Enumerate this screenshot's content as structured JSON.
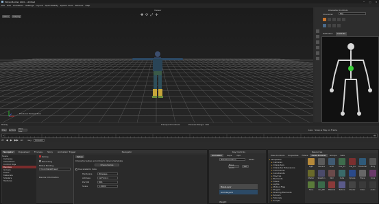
{
  "window": {
    "title": "MotionBuilder 2020 - Untitled",
    "controls": [
      "─",
      "□",
      "✕"
    ]
  },
  "menu": [
    "File",
    "Edit",
    "Animation",
    "Settings",
    "Layout",
    "Open Reality",
    "Python Tools",
    "Window",
    "Help"
  ],
  "viewport": {
    "top_label": "Viewer",
    "left_buttons": [
      "Menu",
      "Display"
    ],
    "camera_label": "Producer Perspective",
    "status_left": "Ready"
  },
  "character_controls": {
    "title": "Character Controls",
    "character_label": "Character",
    "character_value": "Mia",
    "tabs": [
      "Definition",
      "Controls"
    ],
    "active_tab": "Controls"
  },
  "status_bar": {
    "left": "Transport Controls",
    "right": "Preview Range: 100"
  },
  "timeline": {
    "start": "0",
    "end": "100",
    "labels": [
      "Play",
      "Action",
      "Take 001"
    ],
    "key_label": "Key",
    "interp_label": "Smooth",
    "right_labels": [
      "Live",
      "Snap & Play on Frame"
    ]
  },
  "navigator": {
    "title": "Navigator",
    "tabs": [
      "Navigator",
      "Dopesheet",
      "FCurves",
      "Story",
      "Animation Trigger"
    ],
    "active_tab": "Navigator",
    "tree": [
      "Scene",
      "Cameras",
      "Characters",
      "Control Rigs",
      "Devices",
      "Groups",
      "Poses",
      "Materials",
      "Shaders",
      "Textures"
    ],
    "selected": "Devices",
    "props": {
      "enable_label": "Online",
      "recording": "Recording",
      "model_binding": "Model Binding",
      "model_binding_value": "ViconDataStream",
      "setup_tab": "Setup",
      "stream_label": "Character setup according to device template",
      "characterize": "Characterize",
      "use_skeleton": "Use skeleton data",
      "hardware_label": "Hardware",
      "hardware_value": "Wireless",
      "address_label": "Address",
      "address_value": "127.0.0.1",
      "port_label": "Port/ID",
      "port_value": "801",
      "scale_label": "Scale",
      "scale_value": "1.0000",
      "status_info": "Device Information"
    }
  },
  "key_controls": {
    "title": "Key Controls",
    "tabs": [
      "Animation",
      "Keys",
      "Opt"
    ],
    "layer_label": "BaseAnimation",
    "layer_mode": "Mode",
    "base_label": "Base Anim",
    "set_label": "Set",
    "layers": [
      "BaseLayer",
      "AnimLayer1"
    ],
    "footer": "Weight"
  },
  "resources": {
    "title": "Resources",
    "tabs": [
      "Pose Controls",
      "Properties",
      "Filters",
      "Asset Browser",
      "Groups",
      "Sets"
    ],
    "active_tab": "Asset Browser",
    "tree": [
      "Templates",
      "Cameras",
      "Characters",
      "Character Extensions",
      "Commands",
      "Constraints",
      "Devices",
      "Elements",
      "Filters",
      "Lights",
      "Motion Files",
      "Plugins",
      "Shading Elements",
      "Solvers",
      "Tutorials",
      "Scripts"
    ],
    "assets": [
      {
        "label": "Light",
        "color": "#b78a3a"
      },
      {
        "label": "Camera",
        "color": "#5a5a5a"
      },
      {
        "label": "Actor",
        "color": "#405a72"
      },
      {
        "label": "mia_D3",
        "color": "#3e6b4c"
      },
      {
        "label": "mia_D4",
        "color": "#7a2f2f"
      },
      {
        "label": "Character",
        "color": "#2f5a7a"
      },
      {
        "label": "Story",
        "color": "#555"
      },
      {
        "label": "Marker",
        "color": "#6a6a2a"
      },
      {
        "label": "Skeleton",
        "color": "#4a4a6a"
      },
      {
        "label": "Null",
        "color": "#6a4a4a"
      },
      {
        "label": "Cube",
        "color": "#3a6a6a"
      },
      {
        "label": "Sphere",
        "color": "#2a4a8a"
      },
      {
        "label": "Plane",
        "color": "#666"
      },
      {
        "label": "Cone",
        "color": "#6a3a6a"
      },
      {
        "label": "Torus",
        "color": "#5a7a3a"
      },
      {
        "label": "mia_DB",
        "color": "#3a6a4a"
      },
      {
        "label": "Material",
        "color": "#8a3a3a"
      },
      {
        "label": "Texture",
        "color": "#5a5a8a"
      },
      {
        "label": "Shader",
        "color": "#444"
      },
      {
        "label": "Video",
        "color": "#3a3a3a"
      },
      {
        "label": "Audio",
        "color": "#3a3a3a"
      }
    ]
  }
}
